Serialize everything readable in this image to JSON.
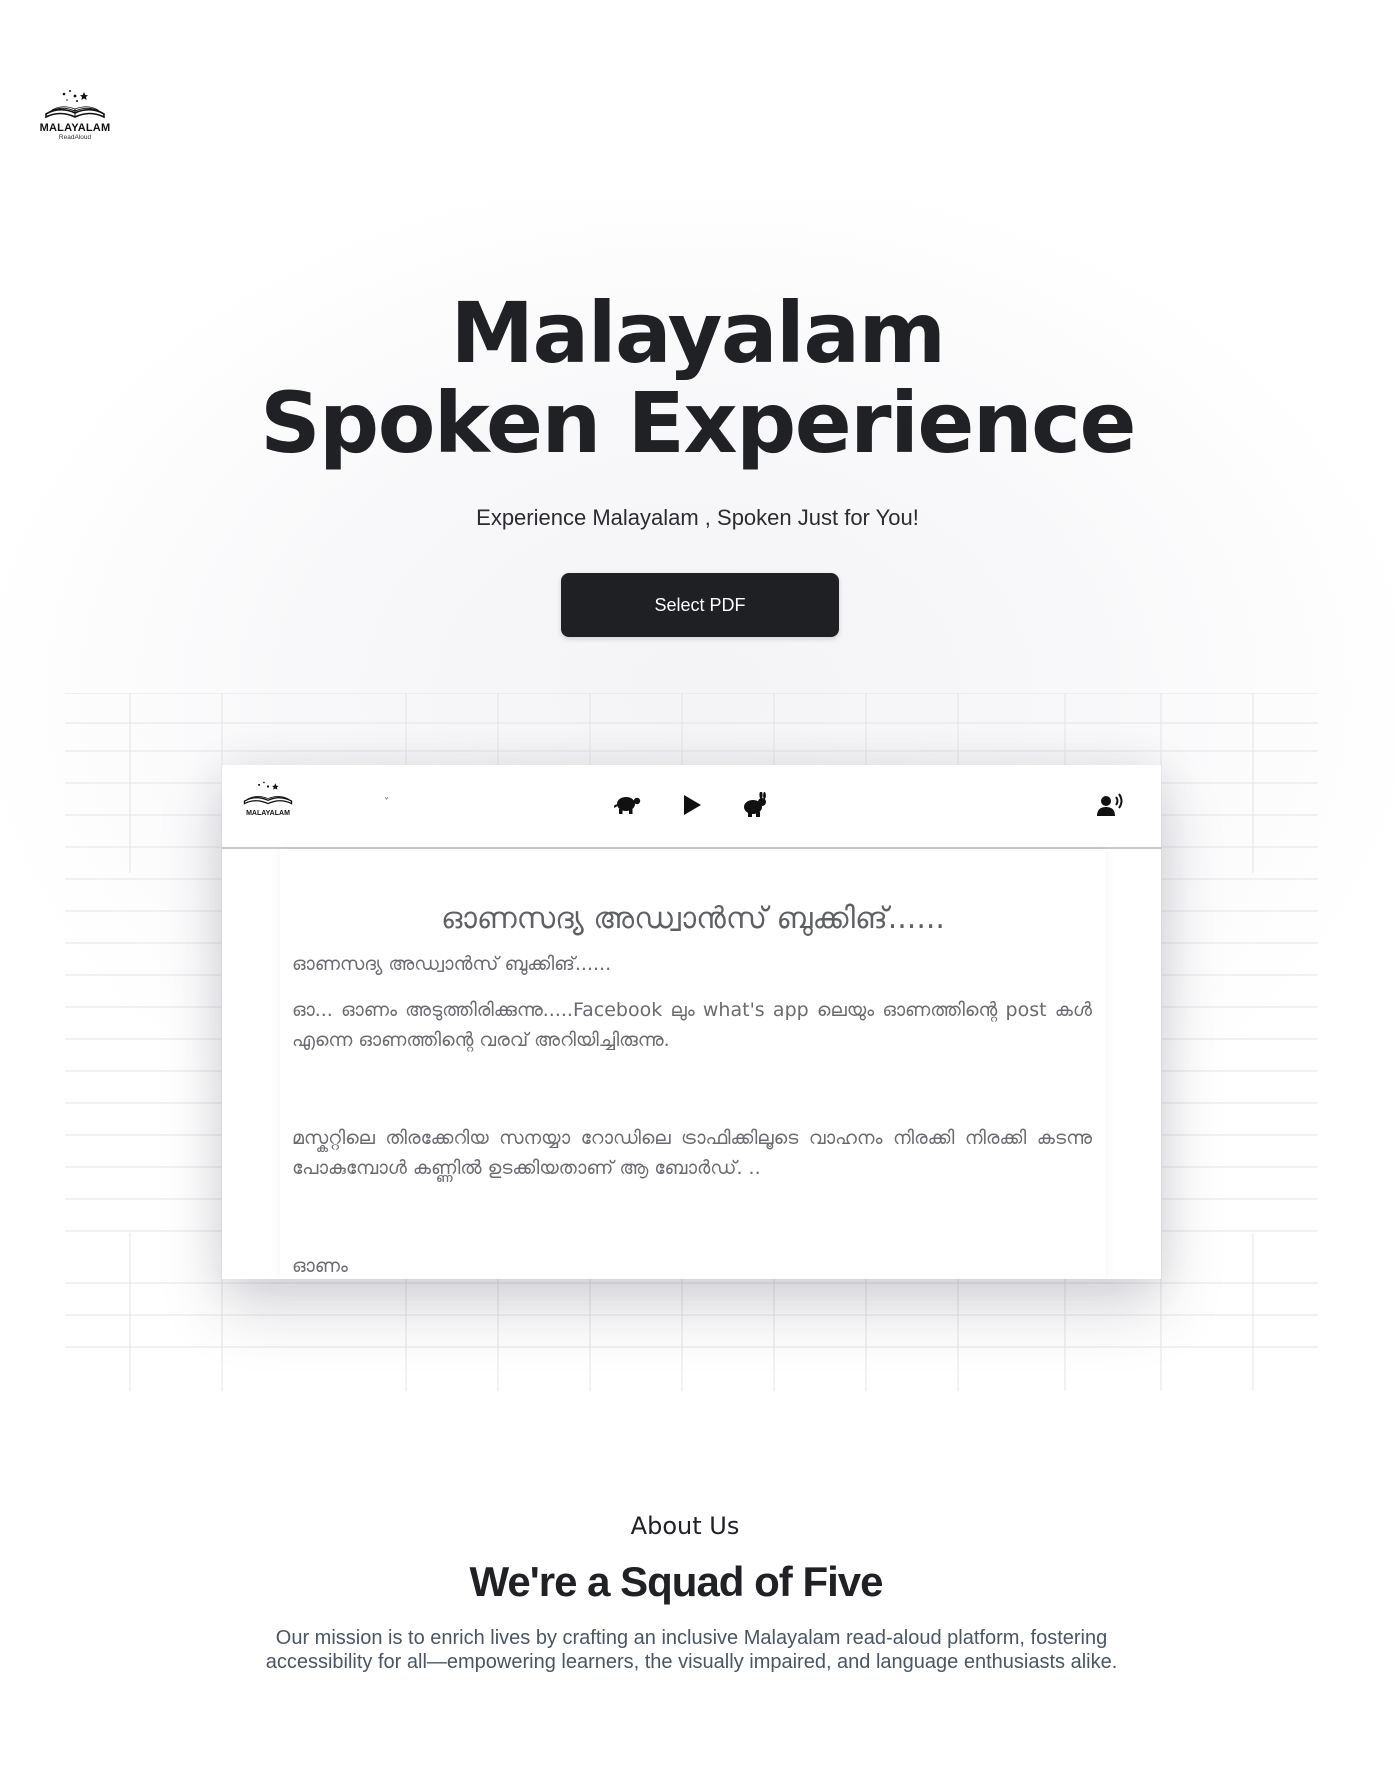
{
  "logo": {
    "brand": "MALAYALAM",
    "sub": "ReadAloud"
  },
  "hero": {
    "title_line1": "Malayalam",
    "title_line2": "Spoken Experience",
    "tagline": "Experience Malayalam , Spoken Just for You!",
    "button_label": "Select PDF"
  },
  "preview": {
    "app_logo_brand": "MALAYALAM",
    "app_logo_sub": "ReadAloud",
    "dropdown_chevron": "˅",
    "icons": [
      "turtle-icon",
      "play-icon",
      "rabbit-icon",
      "voice-icon"
    ],
    "doc_title": "ഓണസദ്യ അഡ്വാൻസ് ബുക്കിങ്......",
    "doc_subtitle": "ഓണസദ്യ അഡ്വാൻസ് ബുക്കിങ്......",
    "paragraph1": "ഓ... ഓണം അടുത്തിരിക്കുന്നു.....Facebook ലും what's app ലെയും ഓണത്തിന്റെ post കൾ എന്നെ ഓണത്തിന്റെ വരവ് അറിയിച്ചിരുന്നു.",
    "paragraph2": "മസ്കറ്റിലെ തിരക്കേറിയ സനയ്യാ റോഡിലെ ട്രാഫിക്കിലൂടെ വാഹനം നിരക്കി നിരക്കി കടന്നു പോകുമ്പോൾ കണ്ണിൽ ഉടക്കിയതാണ് ആ ബോർഡ്. ..",
    "paragraph3": "ഓണം"
  },
  "about": {
    "label": "About Us",
    "title": "We're a Squad of Five",
    "mission": "Our mission is to enrich lives by crafting an inclusive Malayalam read-aloud platform, fostering accessibility for all—empowering learners, the visually impaired, and language enthusiasts alike."
  },
  "colors": {
    "button_bg": "#1f2023",
    "text_dark": "#202124",
    "mission_text": "#4b5563",
    "grid_line": "#e3e4e8"
  }
}
